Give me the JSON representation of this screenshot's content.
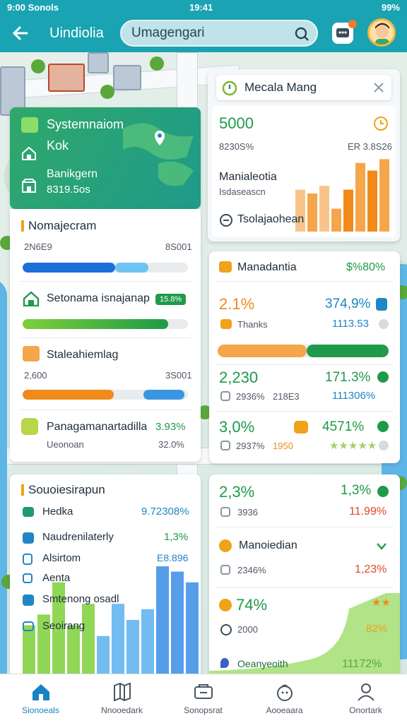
{
  "status": {
    "left": "9:00 Sonols",
    "time": "19:41",
    "battery": "99%"
  },
  "header": {
    "title": "Uindiolia",
    "search_value": "Umagengari",
    "colors": {
      "bar": "#1aa3b2",
      "accent_green": "#1f9a4a",
      "accent_orange": "#f08a1a",
      "accent_blue": "#1f86c6"
    }
  },
  "hero": {
    "title": "Systemnaiom",
    "subtitle": "Kok",
    "label": "Banikgern",
    "value": "8319.5os"
  },
  "card_left": {
    "title": "Nomajecram",
    "row1": {
      "left": "2N6E9",
      "right": "8S001",
      "progress_primary": 0.56,
      "progress_secondary": 0.2
    },
    "row2": {
      "label": "Setonama isnajanap",
      "badge": "15.8%",
      "progress": 0.88
    },
    "row3": {
      "label": "Staleahiemlag",
      "left": "2,600",
      "right": "3S001",
      "progress_orange": 0.55,
      "progress_blue": 0.25
    },
    "row4": {
      "label": "Panagamanartadilla",
      "value": "3.93%",
      "sub": "Ueonoan",
      "sub_value": "32.0%"
    }
  },
  "card_map": {
    "title": "Mecala Mang",
    "value": "5000",
    "sub_left": "8230S%",
    "sub_right": "ER 3.8S26",
    "chart_label": "Manialeotia",
    "chart_sub": "Isdaseascn",
    "footer": "Tsolajaohean",
    "bars": [
      0.55,
      0.5,
      0.6,
      0.3,
      0.55,
      0.9,
      0.8,
      0.95
    ],
    "bar_colors": [
      "#f9c48c",
      "#f5a64b",
      "#f9c48c",
      "#f5a64b",
      "#f08a1a",
      "#f5a64b",
      "#f08a1a",
      "#f5a64b"
    ]
  },
  "card_stats": {
    "title": "Manadantia",
    "title_value": "$%80%",
    "r1": {
      "left": "2.1%",
      "right": "374,9%"
    },
    "r1b": {
      "left": "Thanks",
      "right": "1113.53"
    },
    "progress_orange": 0.52,
    "progress_green": 0.48,
    "r2": {
      "left": "2,230",
      "right": "171.3%"
    },
    "r2b": {
      "left": "2936%",
      "mid": "218E3",
      "right": "111306%"
    },
    "r3": {
      "left": "3,0%",
      "right": "4571%"
    },
    "r3b": {
      "left": "2937%",
      "mid": "1950",
      "stars": "★★★★★"
    }
  },
  "card_bottom_left": {
    "title": "Souoiesirapun",
    "items": [
      {
        "label": "Hedka",
        "value": "9.72308%"
      },
      {
        "label": "Naudrenilaterly",
        "value": "1,3%"
      },
      {
        "label": "Alsirtom",
        "value": "E8.896"
      },
      {
        "label": "Aenta",
        "value": ""
      },
      {
        "label": "Smtenong osadl",
        "value": ""
      },
      {
        "label": "Seoirang",
        "value": ""
      }
    ],
    "chart_bars": [
      0.45,
      0.55,
      0.85,
      0.45,
      0.65,
      0.35,
      0.65,
      0.5,
      0.6,
      1.0,
      0.95,
      0.85
    ]
  },
  "card_bottom_right": {
    "r1": {
      "left": "2,3%",
      "right": "1,3%"
    },
    "r1b": {
      "left": "3936",
      "right": "11.99%"
    },
    "r2": {
      "label": "Manoiedian"
    },
    "r2b": {
      "left": "2346%",
      "right": "1,23%"
    },
    "r3": {
      "left": "74%",
      "stars": "★★"
    },
    "r3b": {
      "left": "2000",
      "right": "82%"
    },
    "r4": {
      "left": "Oeanyeoith",
      "right": "11172%"
    }
  },
  "nav": {
    "items": [
      {
        "label": "Sionoeals",
        "icon": "home-icon"
      },
      {
        "label": "Nnooedark",
        "icon": "map-icon"
      },
      {
        "label": "Sonopsrat",
        "icon": "cart-icon"
      },
      {
        "label": "Aooeaara",
        "icon": "bag-icon"
      },
      {
        "label": "Onortark",
        "icon": "profile-icon"
      }
    ]
  }
}
